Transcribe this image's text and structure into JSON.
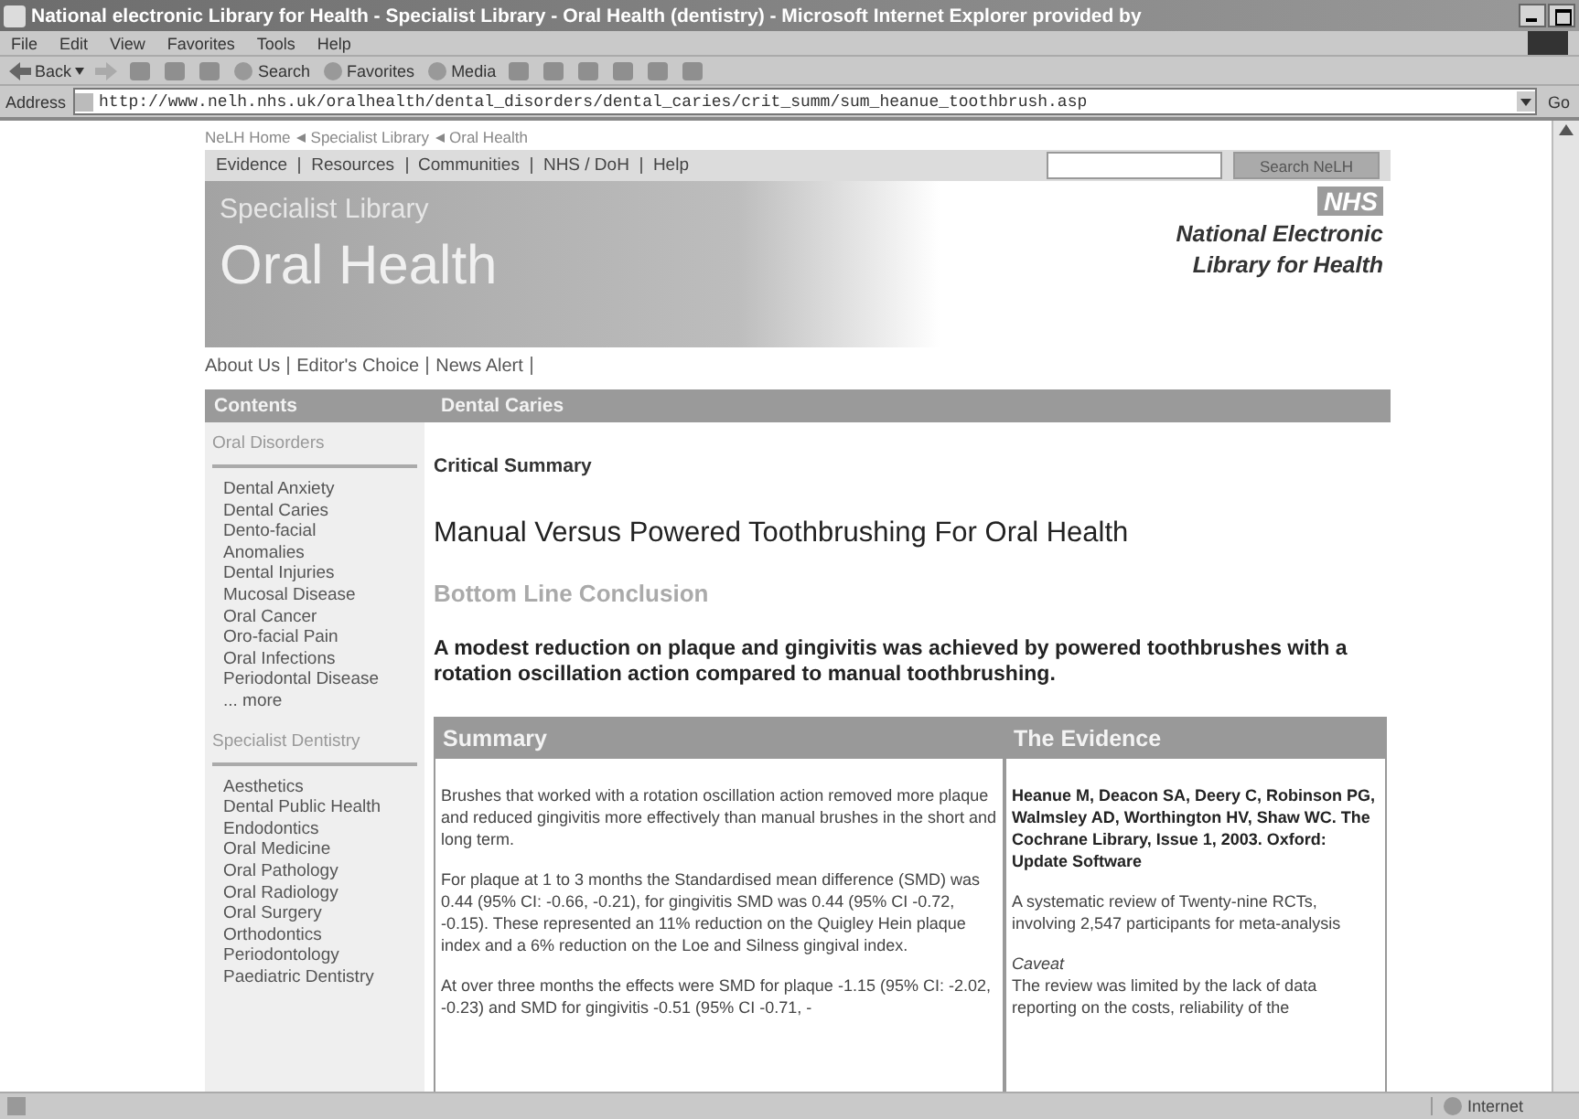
{
  "window": {
    "title": "National electronic Library for Health - Specialist Library - Oral Health (dentistry) - Microsoft Internet Explorer provided by"
  },
  "menu": [
    "File",
    "Edit",
    "View",
    "Favorites",
    "Tools",
    "Help"
  ],
  "toolbar": [
    {
      "kind": "back",
      "label": "Back"
    },
    {
      "kind": "forward"
    },
    {
      "kind": "stop"
    },
    {
      "kind": "refresh"
    },
    {
      "kind": "home"
    },
    {
      "kind": "search",
      "label": "Search"
    },
    {
      "kind": "favorites",
      "label": "Favorites"
    },
    {
      "kind": "media",
      "label": "Media"
    },
    {
      "kind": "history"
    },
    {
      "kind": "mail"
    },
    {
      "kind": "print"
    },
    {
      "kind": "edit"
    },
    {
      "kind": "discuss"
    },
    {
      "kind": "messenger"
    }
  ],
  "address": {
    "label": "Address",
    "url": "http://www.nelh.nhs.uk/oralhealth/dental_disorders/dental_caries/crit_summ/sum_heanue_toothbrush.asp",
    "go": "Go"
  },
  "page": {
    "breadcrumb": [
      "NeLH Home",
      "Specialist Library",
      "Oral Health"
    ],
    "nav": [
      "Evidence",
      "Resources",
      "Communities",
      "NHS / DoH",
      "Help"
    ],
    "search_button": "Search NeLH",
    "banner": {
      "subtitle": "Specialist Library",
      "title": "Oral Health"
    },
    "logo": {
      "badge": "NHS",
      "lines": [
        "National Electronic",
        "Library for Health"
      ]
    },
    "sub_links": [
      "About Us",
      "Editor's Choice",
      "News Alert"
    ],
    "contents_header": "Contents",
    "section_header": "Dental Caries",
    "sidebar": [
      {
        "heading": "Oral Disorders",
        "items": [
          "Dental Anxiety",
          "Dental Caries",
          "Dento-facial",
          "Anomalies",
          "Dental Injuries",
          "Mucosal Disease",
          "Oral Cancer",
          "Oro-facial Pain",
          "Oral Infections",
          "Periodontal Disease",
          "... more"
        ]
      },
      {
        "heading": "Specialist Dentistry",
        "items": [
          "Aesthetics",
          "Dental Public Health",
          "Endodontics",
          "Oral Medicine",
          "Oral Pathology",
          "Oral Radiology",
          "Oral Surgery",
          "Orthodontics",
          "Periodontology",
          "Paediatric Dentistry"
        ]
      }
    ],
    "critical_summary": "Critical Summary",
    "title": "Manual Versus Powered Toothbrushing For Oral Health",
    "bottom_line_heading": "Bottom Line Conclusion",
    "bottom_line": "A modest reduction on plaque and gingivitis was achieved by powered toothbrushes with a rotation oscillation action compared to manual toothbrushing.",
    "summary": {
      "heading": "Summary",
      "paragraphs": [
        "Brushes that worked with a rotation oscillation action removed more plaque and reduced gingivitis more effectively than manual brushes in the short and long term.",
        "For plaque at 1 to 3 months the Standardised mean difference (SMD) was 0.44 (95% CI: -0.66, -0.21), for gingivitis SMD was 0.44 (95% CI -0.72, -0.15). These represented an 11% reduction on the Quigley Hein plaque index and a 6% reduction on the Loe and Silness gingival index.",
        "At over three months the effects were SMD for plaque -1.15 (95% CI: -2.02, -0.23) and SMD for gingivitis -0.51 (95% CI -0.71, -"
      ]
    },
    "evidence": {
      "heading": "The Evidence",
      "paragraphs": [
        {
          "kind": "citation",
          "text": "Heanue M, Deacon SA, Deery C, Robinson PG, Walmsley AD, Worthington HV, Shaw WC. The Cochrane Library, Issue 1, 2003. Oxford: Update Software"
        },
        {
          "kind": "plain",
          "text": "A systematic review of Twenty-nine RCTs, involving 2,547 participants for meta-analysis"
        },
        {
          "kind": "caveat",
          "text": "Caveat"
        },
        {
          "kind": "plain",
          "text": "The review was limited by the lack of data reporting on the costs, reliability of the"
        }
      ]
    }
  },
  "status": {
    "zone": "Internet"
  }
}
